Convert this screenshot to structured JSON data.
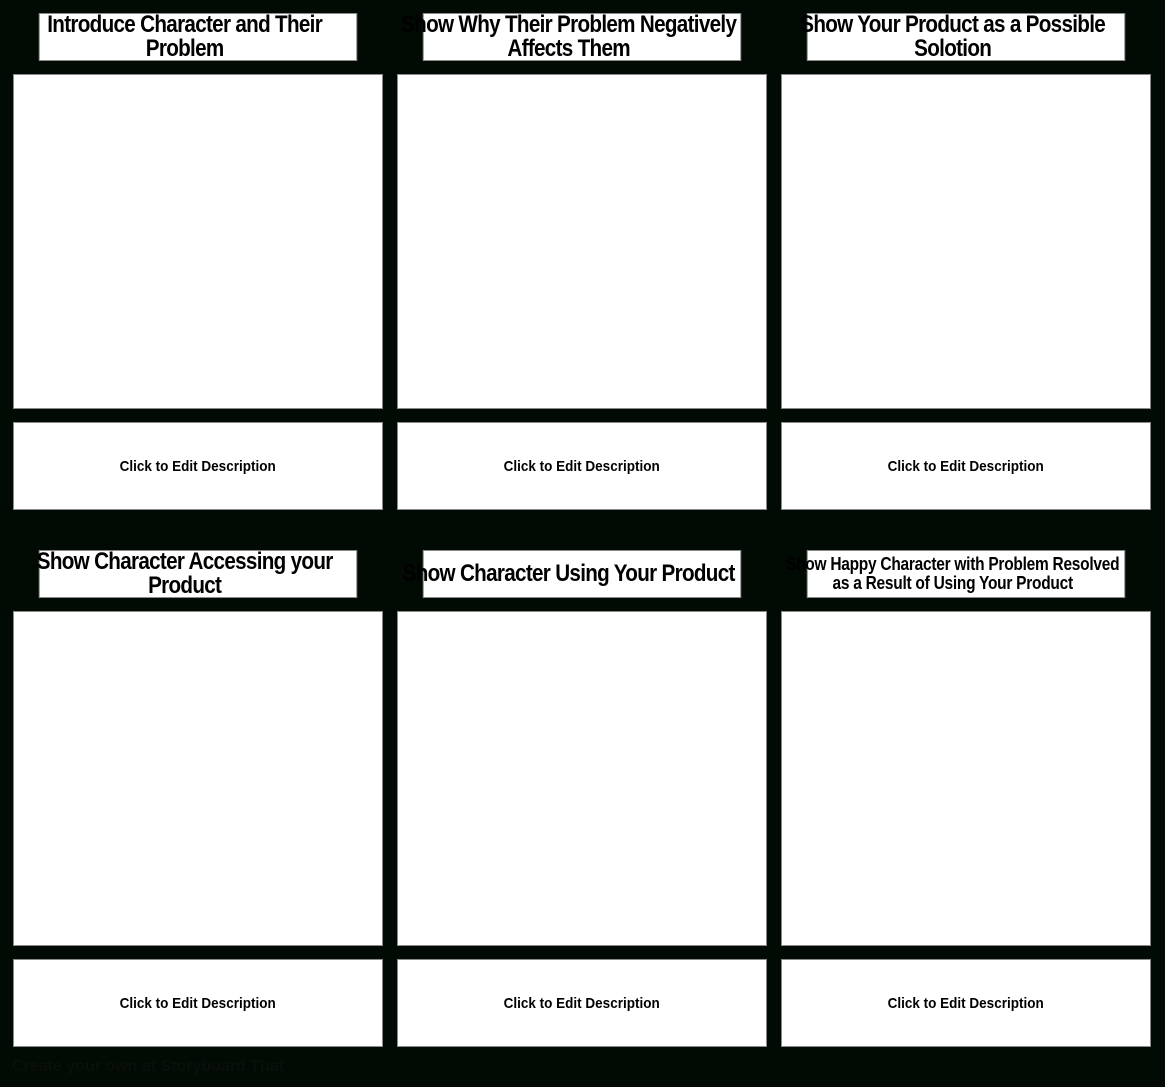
{
  "panels": [
    {
      "title": "Introduce Character and Their Problem",
      "description": "Click to Edit Description"
    },
    {
      "title": "Show Why Their Problem Negatively Affects Them",
      "description": "Click to Edit Description"
    },
    {
      "title": "Show Your Product as a Possible Solotion",
      "description": "Click to Edit Description"
    },
    {
      "title": "Show Character Accessing your Product",
      "description": "Click to Edit Description"
    },
    {
      "title": "Show Character Using Your Product",
      "description": "Click to Edit Description"
    },
    {
      "title": "Show Happy Character with Problem Resolved as a Result of Using Your Product",
      "description": "Click to Edit Description"
    }
  ],
  "footer": "Create your own at Storyboard That"
}
